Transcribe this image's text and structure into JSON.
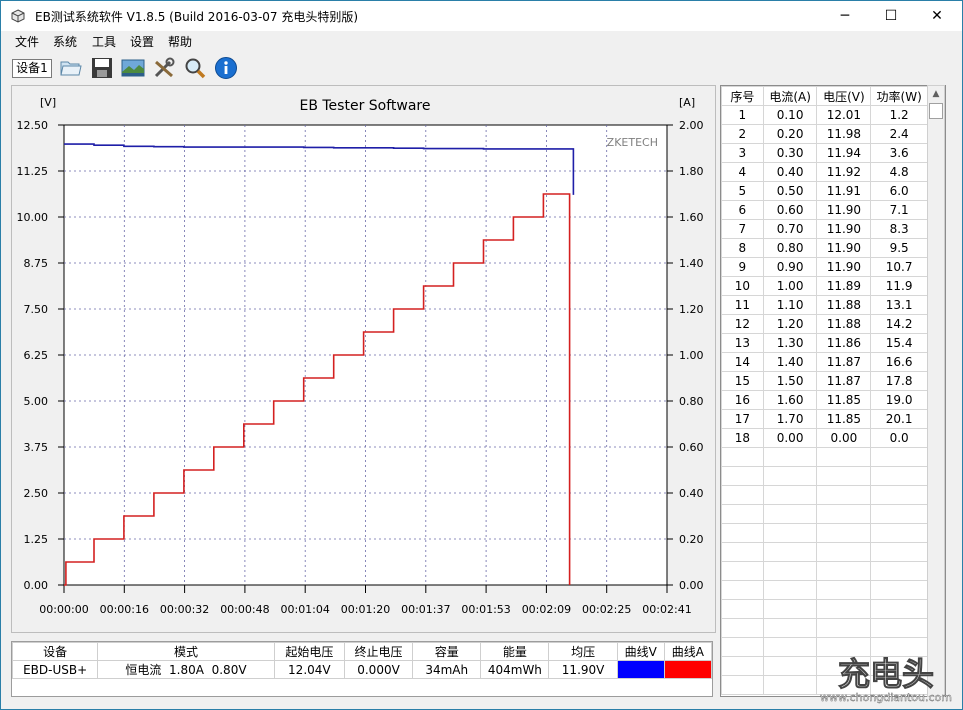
{
  "window": {
    "title": "EB测试系统软件 V1.8.5 (Build 2016-03-07 充电头特别版)",
    "minimize_glyph": "─",
    "maximize_glyph": "☐",
    "close_glyph": "✕"
  },
  "menu": [
    "文件",
    "系统",
    "工具",
    "设置",
    "帮助"
  ],
  "toolbar": {
    "device_tab": "设备1",
    "icons": [
      "folder-open-icon",
      "save-icon",
      "chart-image-icon",
      "tools-icon",
      "magnifier-icon",
      "info-icon"
    ]
  },
  "chart_data": {
    "type": "line",
    "title": "EB Tester Software",
    "left_unit": "[V]",
    "right_unit": "[A]",
    "watermark_label": "ZKETECH",
    "grid": true,
    "y_left_ticks": [
      "12.50",
      "11.25",
      "10.00",
      "8.75",
      "7.50",
      "6.25",
      "5.00",
      "3.75",
      "2.50",
      "1.25",
      "0.00"
    ],
    "y_right_ticks": [
      "2.00",
      "1.80",
      "1.60",
      "1.40",
      "1.20",
      "1.00",
      "0.80",
      "0.60",
      "0.40",
      "0.20",
      "0.00"
    ],
    "x_ticks": [
      "00:00:00",
      "00:00:16",
      "00:00:32",
      "00:00:48",
      "00:01:04",
      "00:01:20",
      "00:01:37",
      "00:01:53",
      "00:02:09",
      "00:02:25",
      "00:02:41"
    ],
    "ylim_left": [
      0,
      12.5
    ],
    "ylim_right": [
      0,
      2.0
    ],
    "xlim_seconds": [
      0,
      161
    ],
    "series": [
      {
        "name": "曲线V",
        "axis": "left",
        "color": "#1f1fa8",
        "x_seconds": [
          0,
          8,
          8,
          16,
          16,
          24,
          24,
          32,
          32,
          40,
          40,
          48,
          48,
          56,
          56,
          64,
          64,
          72,
          72,
          80,
          80,
          88,
          88,
          96,
          96,
          104,
          104,
          112,
          112,
          120,
          120,
          128,
          128,
          136,
          136,
          136
        ],
        "values": [
          11.98,
          11.98,
          11.95,
          11.95,
          11.92,
          11.92,
          11.91,
          11.91,
          11.9,
          11.9,
          11.9,
          11.9,
          11.9,
          11.9,
          11.9,
          11.9,
          11.89,
          11.89,
          11.88,
          11.88,
          11.88,
          11.88,
          11.87,
          11.87,
          11.86,
          11.86,
          11.86,
          11.86,
          11.85,
          11.85,
          11.85,
          11.85,
          11.85,
          11.85,
          11.85,
          10.6
        ]
      },
      {
        "name": "曲线A",
        "axis": "right",
        "color": "#d42020",
        "x_seconds": [
          0,
          0.5,
          0.5,
          8,
          8,
          16,
          16,
          24,
          24,
          32,
          32,
          40,
          40,
          48,
          48,
          56,
          56,
          64,
          64,
          72,
          72,
          80,
          80,
          88,
          88,
          96,
          96,
          104,
          104,
          112,
          112,
          120,
          120,
          128,
          128,
          135,
          135
        ],
        "values": [
          0,
          0,
          0.1,
          0.1,
          0.2,
          0.2,
          0.3,
          0.3,
          0.4,
          0.4,
          0.5,
          0.5,
          0.6,
          0.6,
          0.7,
          0.7,
          0.8,
          0.8,
          0.9,
          0.9,
          1.0,
          1.0,
          1.1,
          1.1,
          1.2,
          1.2,
          1.3,
          1.3,
          1.4,
          1.4,
          1.5,
          1.5,
          1.6,
          1.6,
          1.7,
          1.7,
          0
        ]
      }
    ]
  },
  "readings_table": {
    "headers": [
      "序号",
      "电流(A)",
      "电压(V)",
      "功率(W)"
    ],
    "rows": [
      [
        "1",
        "0.10",
        "12.01",
        "1.2"
      ],
      [
        "2",
        "0.20",
        "11.98",
        "2.4"
      ],
      [
        "3",
        "0.30",
        "11.94",
        "3.6"
      ],
      [
        "4",
        "0.40",
        "11.92",
        "4.8"
      ],
      [
        "5",
        "0.50",
        "11.91",
        "6.0"
      ],
      [
        "6",
        "0.60",
        "11.90",
        "7.1"
      ],
      [
        "7",
        "0.70",
        "11.90",
        "8.3"
      ],
      [
        "8",
        "0.80",
        "11.90",
        "9.5"
      ],
      [
        "9",
        "0.90",
        "11.90",
        "10.7"
      ],
      [
        "10",
        "1.00",
        "11.89",
        "11.9"
      ],
      [
        "11",
        "1.10",
        "11.88",
        "13.1"
      ],
      [
        "12",
        "1.20",
        "11.88",
        "14.2"
      ],
      [
        "13",
        "1.30",
        "11.86",
        "15.4"
      ],
      [
        "14",
        "1.40",
        "11.87",
        "16.6"
      ],
      [
        "15",
        "1.50",
        "11.87",
        "17.8"
      ],
      [
        "16",
        "1.60",
        "11.85",
        "19.0"
      ],
      [
        "17",
        "1.70",
        "11.85",
        "20.1"
      ],
      [
        "18",
        "0.00",
        "0.00",
        "0.0"
      ]
    ],
    "empty_rows": 13
  },
  "summary": {
    "headers": [
      "设备",
      "模式",
      "起始电压",
      "终止电压",
      "容量",
      "能量",
      "均压",
      "曲线V",
      "曲线A"
    ],
    "values": [
      "EBD-USB+",
      "恒电流  1.80A  0.80V",
      "12.04V",
      "0.000V",
      "34mAh",
      "404mWh",
      "11.90V"
    ],
    "curve_v_color": "#0000ff",
    "curve_a_color": "#ff0000"
  },
  "watermark": {
    "brand": "充电头",
    "url": "www.chongdiantou.com"
  }
}
